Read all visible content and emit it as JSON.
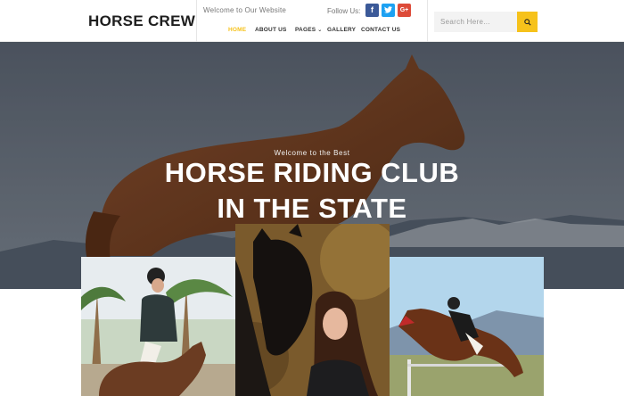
{
  "header": {
    "logo": "HORSE CREW",
    "welcome": "Welcome to Our Website",
    "follow_label": "Follow Us:",
    "social": {
      "facebook": "f",
      "twitter": "t",
      "google_plus": "G+"
    },
    "nav": [
      {
        "label": "HOME",
        "active": true
      },
      {
        "label": "ABOUT US"
      },
      {
        "label": "PAGES"
      },
      {
        "label": "GALLERY"
      },
      {
        "label": "CONTACT US"
      }
    ],
    "search": {
      "placeholder": "Search Here...",
      "icon": "search-icon"
    }
  },
  "hero": {
    "subtitle": "Welcome to the Best",
    "title_line1": "HORSE RIDING CLUB",
    "title_line2": "IN THE STATE"
  },
  "colors": {
    "accent": "#f6c21b",
    "facebook": "#3b5998",
    "twitter": "#1da1f2",
    "google_plus": "#dd4b39"
  }
}
